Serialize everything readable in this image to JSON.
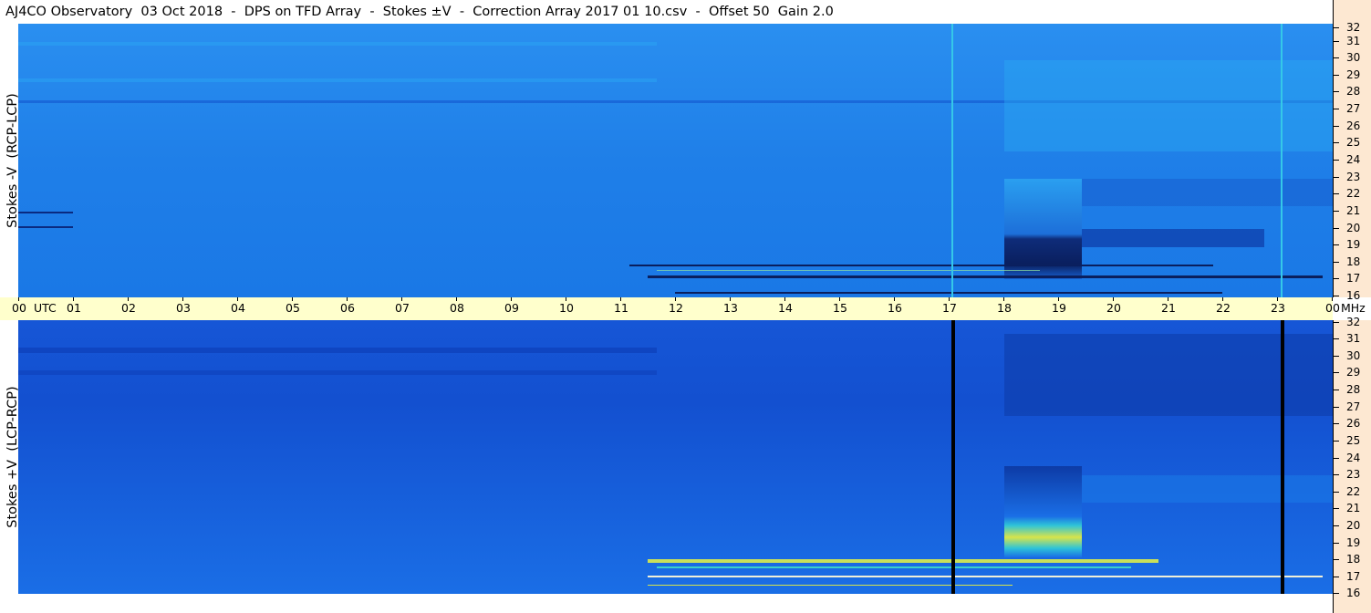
{
  "header": {
    "title": "AJ4CO Observatory  03 Oct 2018  -  DPS on TFD Array  -  Stokes ±V  -  Correction Array 2017 01 10.csv  -  Offset 50  Gain 2.0"
  },
  "panels": {
    "top": {
      "ylabel": "Stokes -V  (RCP-LCP)"
    },
    "bottom": {
      "ylabel": "Stokes +V  (LCP-RCP)"
    }
  },
  "time_axis": {
    "unit_label": "UTC",
    "end_unit": "MHz",
    "labels": [
      "00",
      "01",
      "02",
      "03",
      "04",
      "05",
      "06",
      "07",
      "08",
      "09",
      "10",
      "11",
      "12",
      "13",
      "14",
      "15",
      "16",
      "17",
      "18",
      "19",
      "20",
      "21",
      "22",
      "23",
      "00"
    ]
  },
  "frequency_axis": {
    "labels": [
      "32",
      "31",
      "30",
      "29",
      "28",
      "27",
      "26",
      "25",
      "24",
      "23",
      "22",
      "21",
      "20",
      "19",
      "18",
      "17",
      "16"
    ]
  },
  "colors": {
    "background_blue": "#1a6ee6",
    "deep_blue": "#0d48c8",
    "light_blue": "#2aa0f2",
    "axis_fill": "#ffffcc",
    "freq_axis_fill": "#fde8d2",
    "dark_band": "#0a1f5e"
  }
}
